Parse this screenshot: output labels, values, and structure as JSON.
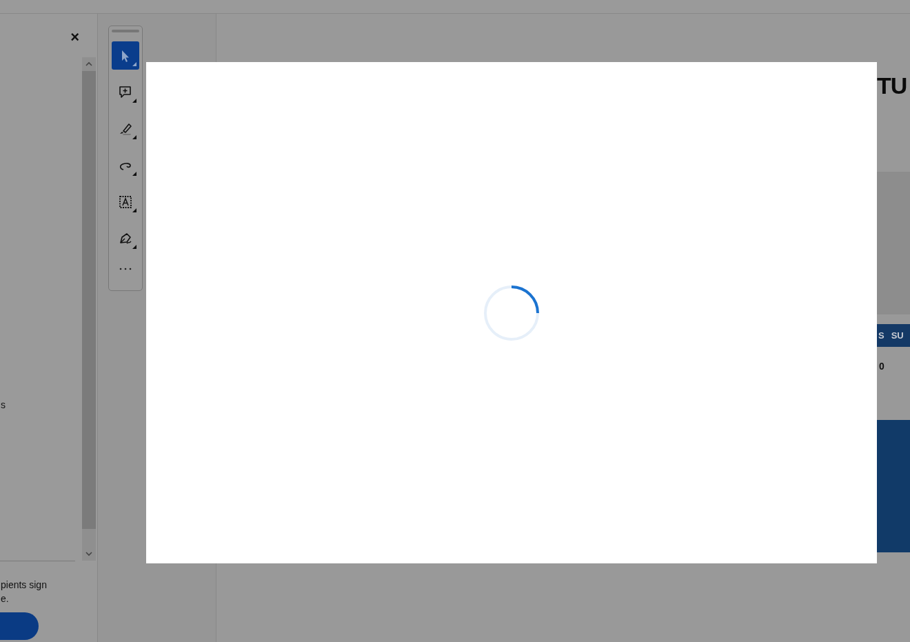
{
  "side_panel": {
    "close": "×",
    "lines": [
      "s"
    ],
    "paragraph_lines": [
      "pients sign",
      "e."
    ]
  },
  "tools": [
    {
      "selected": true
    },
    {
      "selected": false
    },
    {
      "selected": false
    },
    {
      "selected": false
    },
    {
      "selected": false
    },
    {
      "selected": false
    }
  ],
  "document": {
    "heading": "TU",
    "table": {
      "columns": [
        "S",
        "SU"
      ],
      "rows": [
        [
          "0"
        ]
      ]
    }
  },
  "modal": {
    "loading": true
  }
}
